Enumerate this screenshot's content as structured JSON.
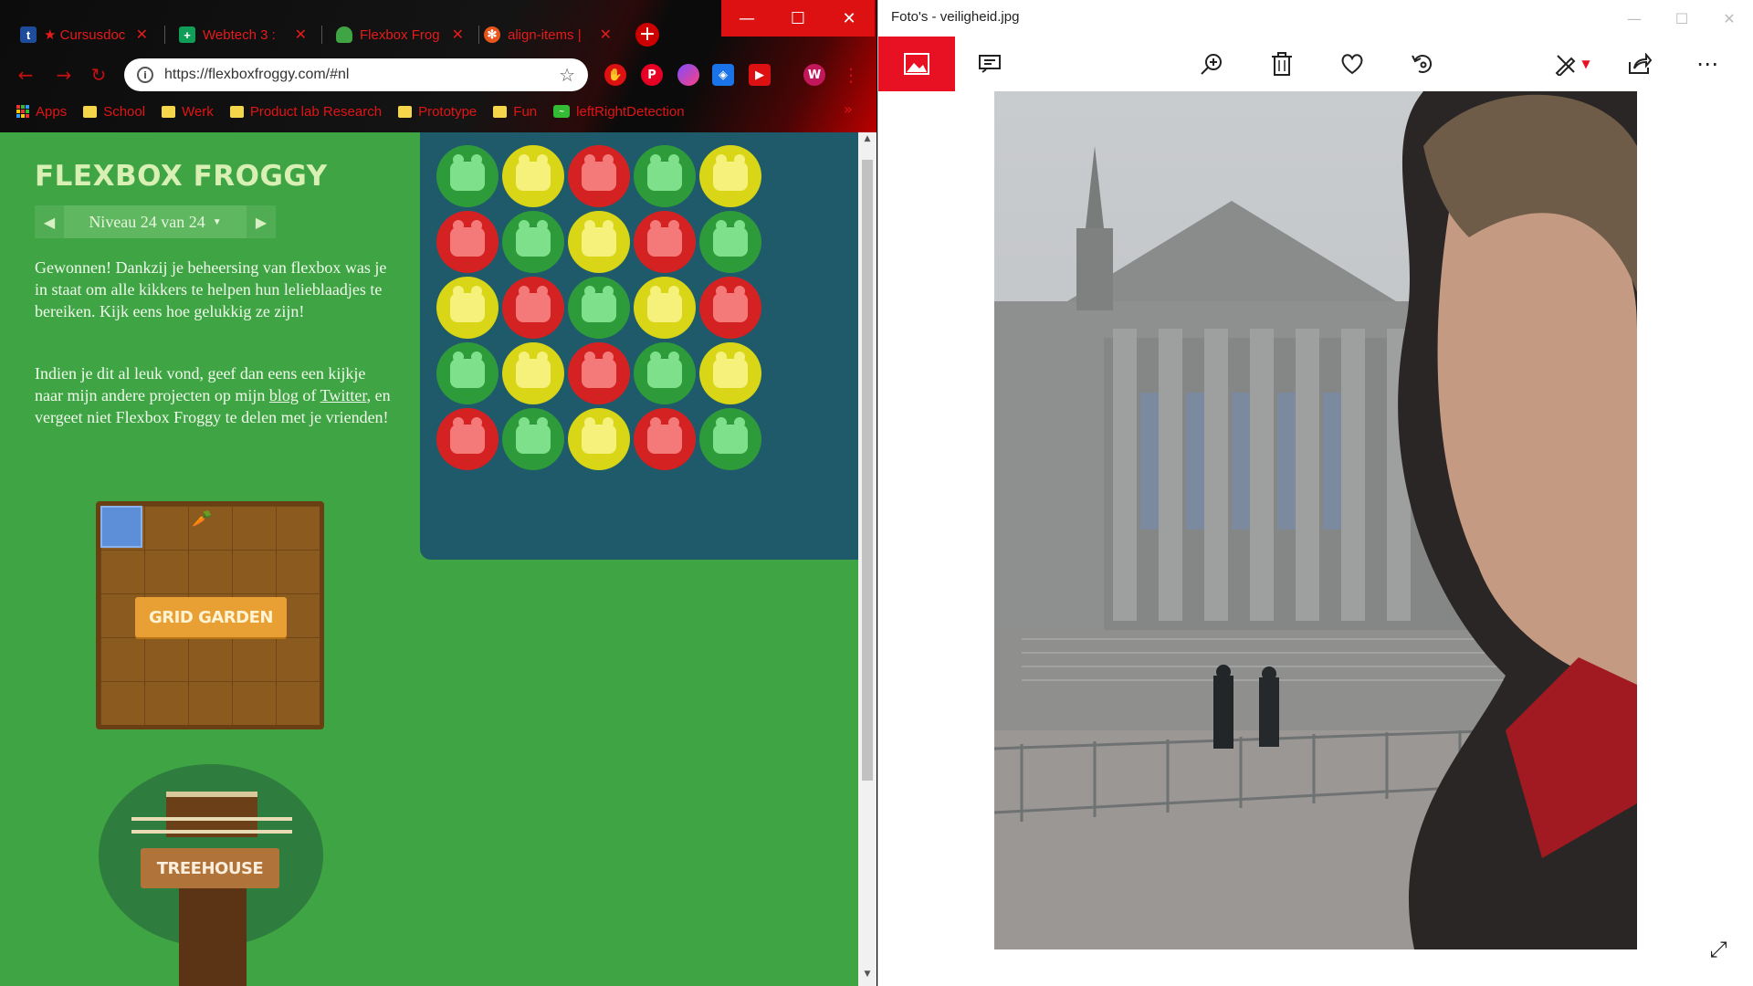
{
  "chrome": {
    "tabs": [
      {
        "title": "★ Cursusdoc",
        "icon": "tumblr-icon",
        "icon_text": "t",
        "color": "#1e4c9a"
      },
      {
        "title": "Webtech 3 :",
        "icon": "sheets-icon",
        "icon_text": "+",
        "color": "#0f9d58"
      },
      {
        "title": "Flexbox Frog",
        "icon": "frog-icon",
        "icon_text": "",
        "color": "#3fa443"
      },
      {
        "title": "align-items |",
        "icon": "cssplus-icon",
        "icon_text": "✻",
        "color": "#e8561b"
      }
    ],
    "url": "https://flexboxfroggy.com/#nl",
    "bookmarks": [
      "Apps",
      "School",
      "Werk",
      "Product lab Research",
      "Prototype",
      "Fun",
      "leftRightDetection"
    ],
    "profile_initial": "W"
  },
  "game": {
    "title": "FLEXBOX FROGGY",
    "level_label": "Niveau 24 van 24",
    "para1": "Gewonnen! Dankzij je beheersing van flexbox was je in staat om alle kikkers te helpen hun lelieblaadjes te bereiken. Kijk eens hoe gelukkig ze zijn!",
    "para2_pre": "Indien je dit al leuk vond, geef dan eens een kijkje naar mijn andere projecten op mijn ",
    "para2_link1": "blog",
    "para2_mid": " of ",
    "para2_link2": "Twitter",
    "para2_post": ", en vergeet niet Flexbox Froggy te delen met je vrienden!",
    "grid_garden_label": "GRID GARDEN",
    "treehouse_label": "TREEHOUSE",
    "pond": [
      [
        "green",
        "yellow",
        "red",
        "green",
        "yellow"
      ],
      [
        "red",
        "green",
        "yellow",
        "red",
        "green"
      ],
      [
        "yellow",
        "red",
        "green",
        "yellow",
        "red"
      ],
      [
        "green",
        "yellow",
        "red",
        "green",
        "yellow"
      ],
      [
        "red",
        "green",
        "yellow",
        "red",
        "green"
      ]
    ]
  },
  "photos": {
    "title": "Foto's - veiligheid.jpg",
    "toolbar": [
      "slideshow-icon",
      "zoom-icon",
      "delete-icon",
      "favorite-icon",
      "rotate-icon",
      "edit-icon",
      "share-icon",
      "more-icon"
    ]
  },
  "colors": {
    "accent_red": "#e81123",
    "game_green": "#3fa443",
    "pond_blue": "#1f5a6a"
  }
}
